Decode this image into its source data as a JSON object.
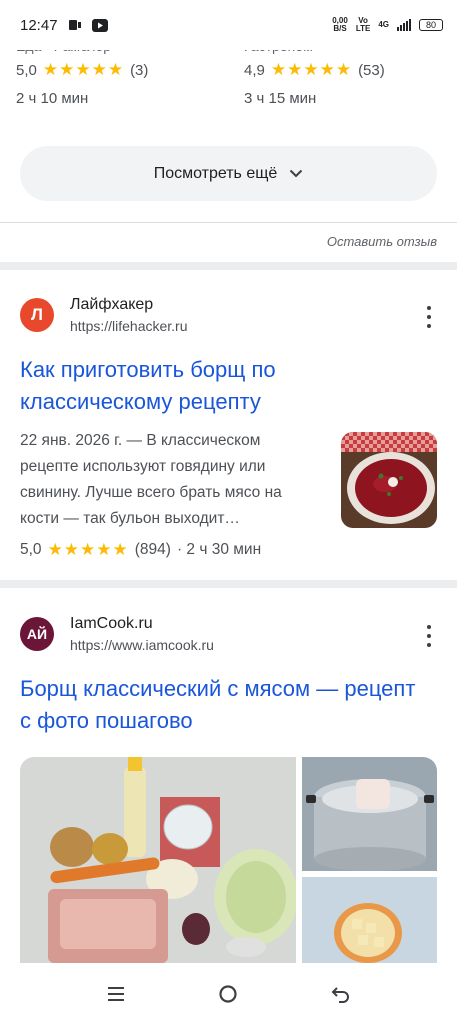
{
  "status": {
    "time": "12:47",
    "speed_value": "0,00",
    "speed_unit": "B/S",
    "volte_top": "Vo",
    "volte_bottom": "LTE",
    "network": "4G",
    "battery": "80"
  },
  "partial_results": [
    {
      "source": "Еда · Рамблер",
      "rating": "5,0",
      "stars": "★★★★★",
      "count": "(3)",
      "time": "2 ч 10 мин"
    },
    {
      "source": "Гастроном",
      "rating": "4,9",
      "stars": "★★★★★",
      "count": "(53)",
      "time": "3 ч 15 мин"
    }
  ],
  "more_button": {
    "label": "Посмотреть ещё"
  },
  "feedback_link": "Оставить отзыв",
  "results": [
    {
      "favicon_letter": "Л",
      "favicon_color": "#e8482c",
      "site_name": "Лайфхакер",
      "url": "https://lifehacker.ru",
      "title": "Как приготовить борщ по классическому рецепту",
      "snippet": "22 янв. 2026 г. — В классическом рецепте используют говядину или свинину. Лучше всего брать мясо на кости — так бульон выходит…",
      "rating": "5,0",
      "stars": "★★★★★",
      "count": "(894)",
      "time": "· 2 ч 30 мин"
    },
    {
      "favicon_letter": "АЙ",
      "favicon_color": "#6b1538",
      "site_name": "IamCook.ru",
      "url": "https://www.iamcook.ru",
      "title": "Борщ классический с мясом — рецепт с фото пошагово"
    }
  ],
  "icons": {
    "kebab": "more-vert-icon",
    "chevron": "chevron-down-icon",
    "nav_menu": "menu-icon",
    "nav_home": "home-icon",
    "nav_back": "back-icon"
  },
  "colors": {
    "link": "#1a56db",
    "star": "#fbbc04",
    "button_bg": "#f1f3f4"
  }
}
